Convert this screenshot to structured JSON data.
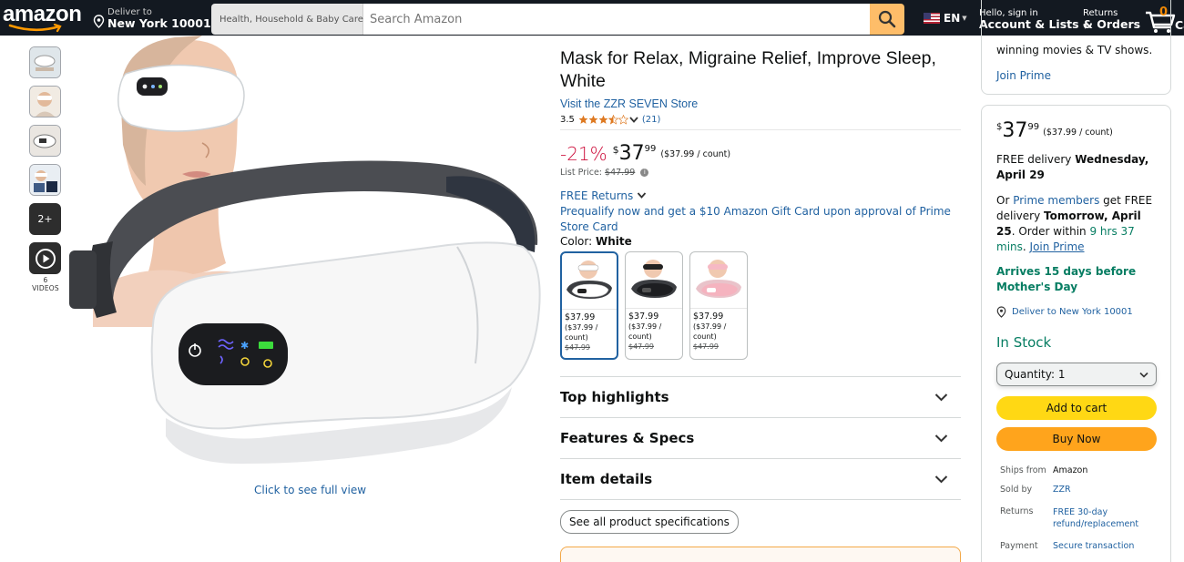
{
  "header": {
    "logo_text": "amazon",
    "deliver_line1": "Deliver to",
    "deliver_line2": "New York 10001",
    "search_category": "Health, Household & Baby Care",
    "search_placeholder": "Search Amazon",
    "language": "EN",
    "account_line1": "Hello, sign in",
    "account_line2": "Account & Lists",
    "returns_line1": "Returns",
    "returns_line2": "& Orders",
    "cart_count": "0",
    "cart_label": "Ca"
  },
  "gallery": {
    "more_label": "2+",
    "videos_label": "6 VIDEOS",
    "full_view_link": "Click to see full view"
  },
  "product": {
    "title": "Mask for Relax, Migraine Relief, Improve Sleep, White",
    "store_link": "Visit the ZZR SEVEN Store",
    "rating": "3.5",
    "rating_value": 3.5,
    "rating_count": "(21)",
    "discount": "-21%",
    "price_symbol": "$",
    "price_whole": "37",
    "price_fraction": "99",
    "price_per_unit": "($37.99 / count)",
    "list_price_label": "List Price:",
    "list_price": "$47.99",
    "free_returns": "FREE Returns",
    "prequalify": "Prequalify now and get a $10 Amazon Gift Card upon approval of Prime Store Card",
    "color_label": "Color:",
    "color_value": "White",
    "swatches": [
      {
        "price": "$37.99",
        "unit": "($37.99 / count)",
        "list": "$47.99",
        "color": "white"
      },
      {
        "price": "$37.99",
        "unit": "($37.99 / count)",
        "list": "$47.99",
        "color": "black"
      },
      {
        "price": "$37.99",
        "unit": "($37.99 / count)",
        "list": "$47.99",
        "color": "pink"
      }
    ],
    "sections": [
      "Top highlights",
      "Features & Specs",
      "Item details"
    ],
    "spec_button": "See all product specifications"
  },
  "buybox": {
    "prime_text": "winning movies & TV shows.",
    "join_prime": "Join Prime",
    "price_symbol": "$",
    "price_whole": "37",
    "price_fraction": "99",
    "price_per_unit": "($37.99 / count)",
    "free_delivery_prefix": "FREE delivery ",
    "free_delivery_date": "Wednesday, April 29",
    "or_prefix": "Or ",
    "prime_members": "Prime members",
    "fastest_text": " get FREE delivery ",
    "fastest_date": "Tomorrow, April 25",
    "order_within_prefix": ". Order within ",
    "order_within": "9 hrs 37 mins",
    "join_prime_link": "Join Prime",
    "mothers_day": "Arrives 15 days before Mother's Day",
    "deliver_to": "Deliver to New York 10001",
    "stock": "In Stock",
    "quantity_label": "Quantity:",
    "quantity_value": "1",
    "add_to_cart": "Add to cart",
    "buy_now": "Buy Now",
    "ships_from_label": "Ships from",
    "ships_from": "Amazon",
    "sold_by_label": "Sold by",
    "sold_by": "ZZR",
    "returns_label": "Returns",
    "returns_value": "FREE 30-day refund/replacement",
    "payment_label": "Payment",
    "payment_value": "Secure transaction"
  },
  "colors": {
    "nav_bg": "#131921",
    "link": "#2162a1",
    "discount": "#cc0c39",
    "green": "#067d62",
    "add_to_cart": "#ffd814",
    "buy_now": "#ffa41c",
    "star": "#de7921"
  }
}
